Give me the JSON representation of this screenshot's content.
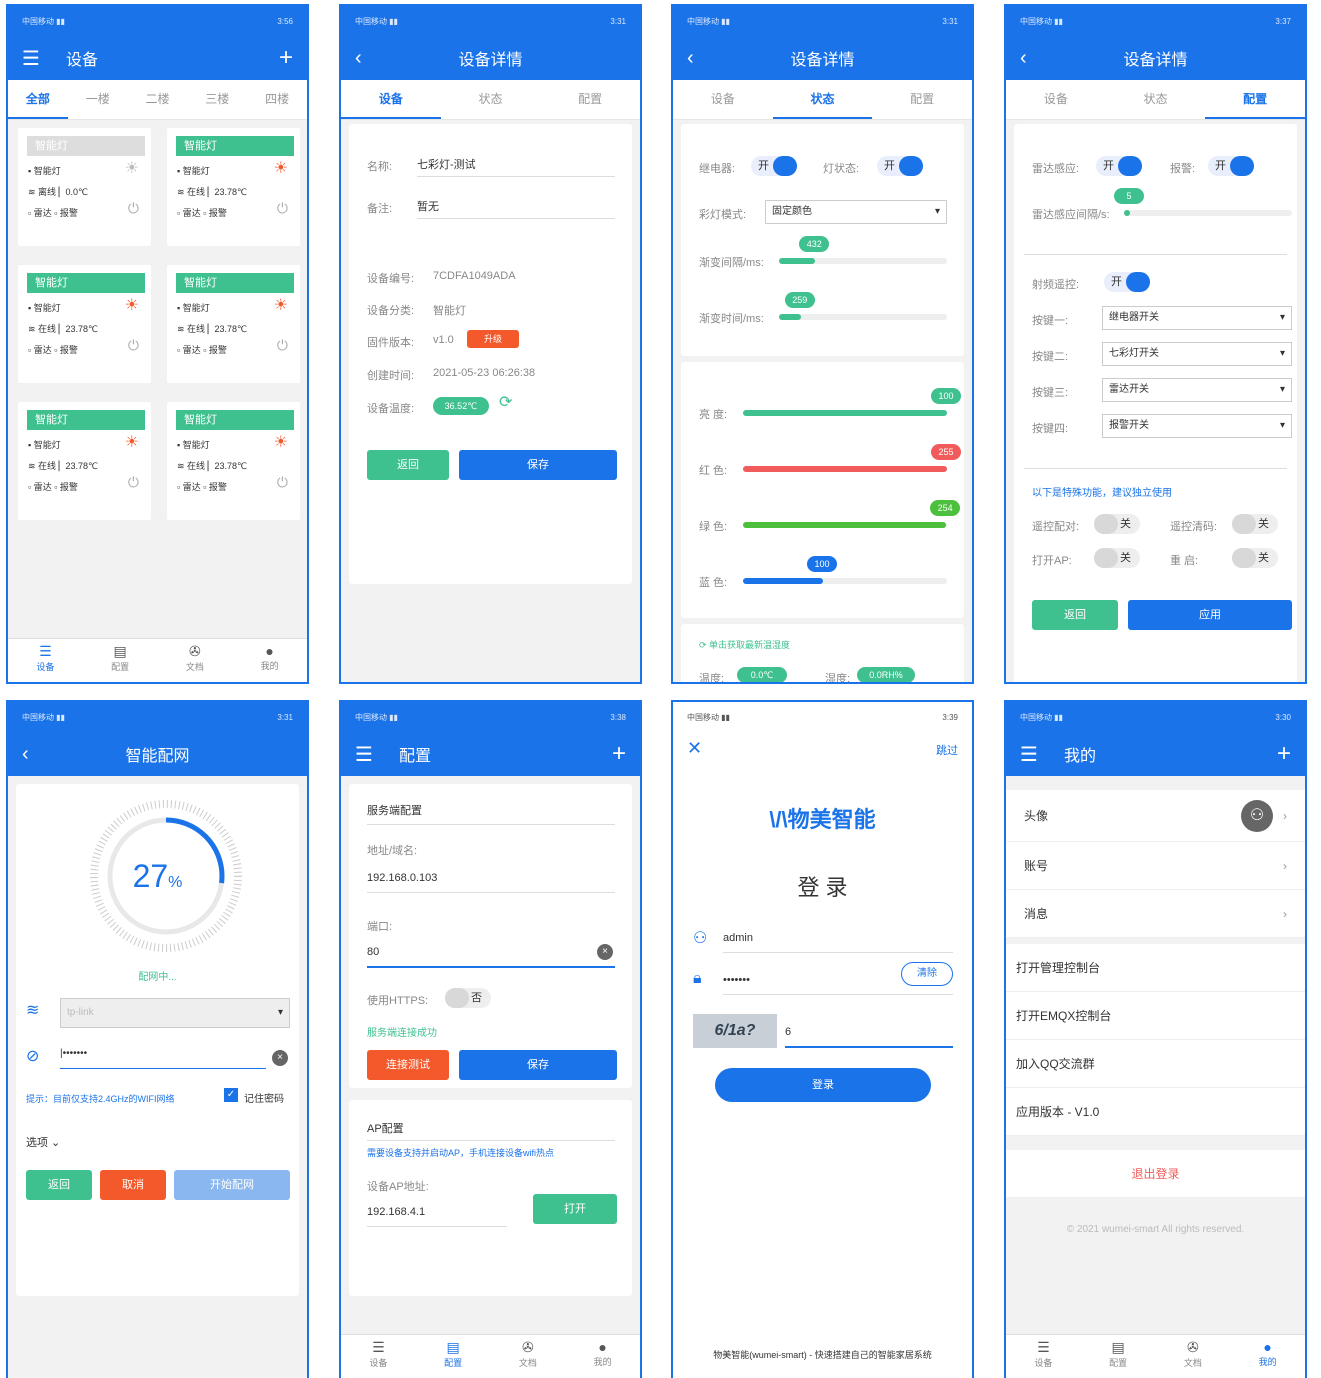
{
  "status": {
    "p1_time": "3:56",
    "p2_time": "3:31",
    "p3_time": "3:31",
    "p4_time": "3:37",
    "p5_time": "3:31",
    "p6_time": "3:38",
    "p7_time": "3:39",
    "p8_time": "3:30"
  },
  "device_list": {
    "title": "设备",
    "tabs": [
      "全部",
      "一楼",
      "二楼",
      "三楼",
      "四楼"
    ],
    "cards": [
      {
        "name": "智能灯",
        "type": "智能灯",
        "net": "离线",
        "temp": "0.0℃",
        "radar": "雷达",
        "alarm": "报警"
      },
      {
        "name": "智能灯",
        "type": "智能灯",
        "net": "在线",
        "temp": "23.78℃",
        "radar": "雷达",
        "alarm": "报警"
      },
      {
        "name": "智能灯",
        "type": "智能灯",
        "net": "在线",
        "temp": "23.78℃",
        "radar": "雷达",
        "alarm": "报警"
      },
      {
        "name": "智能灯",
        "type": "智能灯",
        "net": "在线",
        "temp": "23.78℃",
        "radar": "雷达",
        "alarm": "报警"
      },
      {
        "name": "智能灯",
        "type": "智能灯",
        "net": "在线",
        "temp": "23.78℃",
        "radar": "雷达",
        "alarm": "报警"
      },
      {
        "name": "智能灯",
        "type": "智能灯",
        "net": "在线",
        "temp": "23.78℃",
        "radar": "雷达",
        "alarm": "报警"
      }
    ]
  },
  "nav": {
    "devices": "设备",
    "config": "配置",
    "docs": "文档",
    "mine": "我的"
  },
  "detail": {
    "title": "设备详情",
    "tabs": [
      "设备",
      "状态",
      "配置"
    ],
    "name_label": "名称:",
    "name_value": "七彩灯-测试",
    "remark_label": "备注:",
    "remark_value": "暂无",
    "sn_label": "设备编号:",
    "sn_value": "7CDFA1049ADA",
    "cat_label": "设备分类:",
    "cat_value": "智能灯",
    "fw_label": "固件版本:",
    "fw_value": "v1.0",
    "upgrade": "升级",
    "created_label": "创建时间:",
    "created_value": "2021-05-23 06:26:38",
    "temp_label": "设备温度:",
    "temp_value": "36.52℃",
    "back": "返回",
    "save": "保存"
  },
  "state": {
    "relay_label": "继电器:",
    "relay": "开",
    "lamp_label": "灯状态:",
    "lamp": "开",
    "mode_label": "彩灯模式:",
    "mode_value": "固定颜色",
    "grad_int_label": "渐变间隔/ms:",
    "grad_int": 432,
    "grad_time_label": "渐变时间/ms:",
    "grad_time": 259,
    "brightness_label": "亮 度:",
    "brightness": 100,
    "red_label": "红 色:",
    "red": 255,
    "green_label": "绿 色:",
    "green": 254,
    "blue_label": "蓝 色:",
    "blue": 100,
    "refresh": "单击获取最新温湿度",
    "temp_label": "温度:",
    "temp": "0.0℃",
    "hum_label": "湿度:",
    "hum": "0.0RH%"
  },
  "cfg": {
    "radar_label": "雷达感应:",
    "radar": "开",
    "alarm_label": "报警:",
    "alarm": "开",
    "radar_int_label": "雷达感应间隔/s:",
    "radar_int": 5,
    "rf_label": "射频遥控:",
    "rf": "开",
    "k1_label": "按键一:",
    "k1": "继电器开关",
    "k2_label": "按键二:",
    "k2": "七彩灯开关",
    "k3_label": "按键三:",
    "k3": "雷达开关",
    "k4_label": "按键四:",
    "k4": "报警开关",
    "special": "以下是特殊功能，建议独立使用",
    "pair_label": "遥控配对:",
    "pair": "关",
    "clear_label": "遥控清码:",
    "clear": "关",
    "ap_label": "打开AP:",
    "ap": "关",
    "restart_label": "重 启:",
    "restart": "关",
    "back": "返回",
    "apply": "应用"
  },
  "wifi": {
    "title": "智能配网",
    "percent": "27",
    "pct_sign": "%",
    "progress": 0.27,
    "status": "配网中...",
    "ssid_placeholder": "tp-link",
    "tip": "提示：目前仅支持2.4GHz的WIFI网络",
    "remember": "记住密码",
    "options": "选项",
    "back": "返回",
    "cancel": "取消",
    "start": "开始配网"
  },
  "config": {
    "title": "配置",
    "server_title": "服务端配置",
    "addr_label": "地址/域名:",
    "addr": "192.168.0.103",
    "port_label": "端口:",
    "port": "80",
    "https_label": "使用HTTPS:",
    "https": "否",
    "ok": "服务端连接成功",
    "test": "连接测试",
    "save": "保存",
    "ap_title": "AP配置",
    "ap_tip": "需要设备支持并启动AP，手机连接设备wifi热点",
    "ap_addr_label": "设备AP地址:",
    "ap_addr": "192.168.4.1",
    "open": "打开"
  },
  "login": {
    "skip": "跳过",
    "brand": "物美智能",
    "title": "登 录",
    "user": "admin",
    "pwd": "•••••••",
    "clear": "清除",
    "captcha": "6/1a?",
    "code": "6",
    "login": "登录",
    "footer": "物美智能(wumei-smart) - 快速搭建自己的智能家居系统"
  },
  "mine": {
    "title": "我的",
    "avatar": "头像",
    "account": "账号",
    "message": "消息",
    "m1": "打开管理控制台",
    "m2": "打开EMQX控制台",
    "m3": "加入QQ交流群",
    "m4": "应用版本 - V1.0",
    "logout": "退出登录",
    "copyright": "© 2021 wumei-smart All rights reserved."
  },
  "colors": {
    "primary": "#1a73e8",
    "green": "#3ec18f",
    "red": "#f4592b"
  }
}
